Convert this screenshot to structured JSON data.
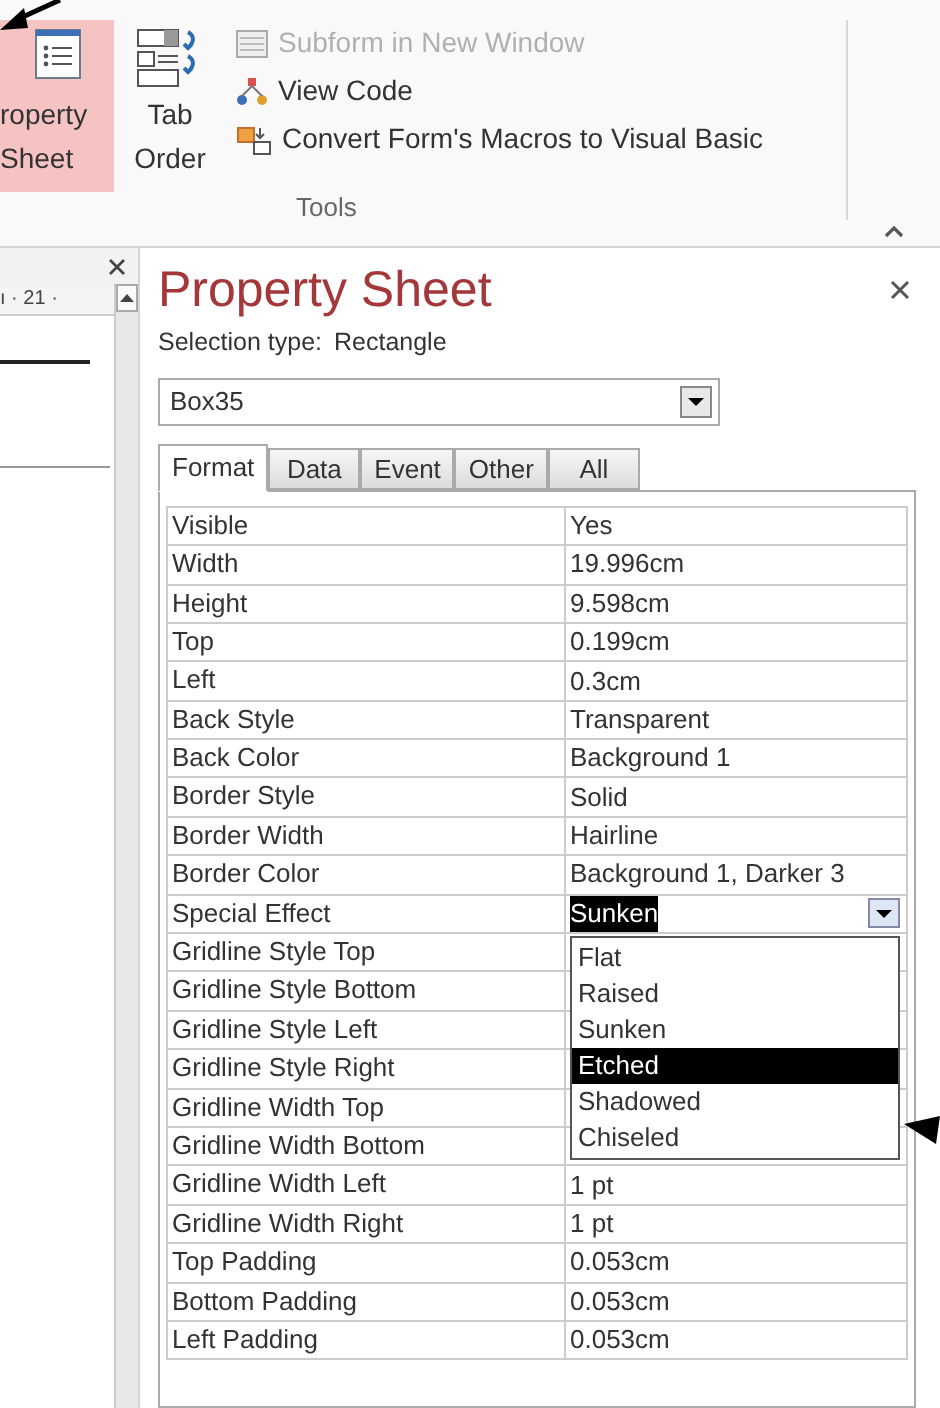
{
  "ribbon": {
    "large_buttons": [
      {
        "label": "roperty Sheet",
        "selected": true
      },
      {
        "label": "Tab Order",
        "selected": false
      }
    ],
    "small_buttons": [
      {
        "label": "Subform in New Window",
        "disabled": true
      },
      {
        "label": "View Code",
        "disabled": false
      },
      {
        "label": "Convert Form's Macros to Visual Basic",
        "disabled": false
      }
    ],
    "group_label": "Tools"
  },
  "left_pane": {
    "ruler": "ı · 21 ·"
  },
  "property_sheet": {
    "title": "Property Sheet",
    "selection_type_label": "Selection type:",
    "selection_type": "Rectangle",
    "object": "Box35",
    "tabs": [
      {
        "label": "Format",
        "selected": true
      },
      {
        "label": "Data",
        "selected": false
      },
      {
        "label": "Event",
        "selected": false
      },
      {
        "label": "Other",
        "selected": false
      },
      {
        "label": "All",
        "selected": false
      }
    ],
    "rows": [
      {
        "name": "Visible",
        "value": "Yes"
      },
      {
        "name": "Width",
        "value": "19.996cm"
      },
      {
        "name": "Height",
        "value": "9.598cm"
      },
      {
        "name": "Top",
        "value": "0.199cm"
      },
      {
        "name": "Left",
        "value": "0.3cm"
      },
      {
        "name": "Back Style",
        "value": "Transparent"
      },
      {
        "name": "Back Color",
        "value": "Background 1"
      },
      {
        "name": "Border Style",
        "value": "Solid"
      },
      {
        "name": "Border Width",
        "value": "Hairline"
      },
      {
        "name": "Border Color",
        "value": "Background 1, Darker 3"
      },
      {
        "name": "Special Effect",
        "value": "Sunken",
        "editing": true
      },
      {
        "name": "Gridline Style Top"
      },
      {
        "name": "Gridline Style Bottom"
      },
      {
        "name": "Gridline Style Left"
      },
      {
        "name": "Gridline Style Right"
      },
      {
        "name": "Gridline Width Top"
      },
      {
        "name": "Gridline Width Bottom"
      },
      {
        "name": "Gridline Width Left",
        "value": "1 pt"
      },
      {
        "name": "Gridline Width Right",
        "value": "1 pt"
      },
      {
        "name": "Top Padding",
        "value": "0.053cm"
      },
      {
        "name": "Bottom Padding",
        "value": "0.053cm"
      },
      {
        "name": "Left Padding",
        "value": "0.053cm"
      }
    ],
    "dropdown_options": [
      {
        "label": "Flat",
        "selected": false
      },
      {
        "label": "Raised",
        "selected": false
      },
      {
        "label": "Sunken",
        "selected": false
      },
      {
        "label": "Etched",
        "selected": true
      },
      {
        "label": "Shadowed",
        "selected": false
      },
      {
        "label": "Chiseled",
        "selected": false
      }
    ]
  }
}
